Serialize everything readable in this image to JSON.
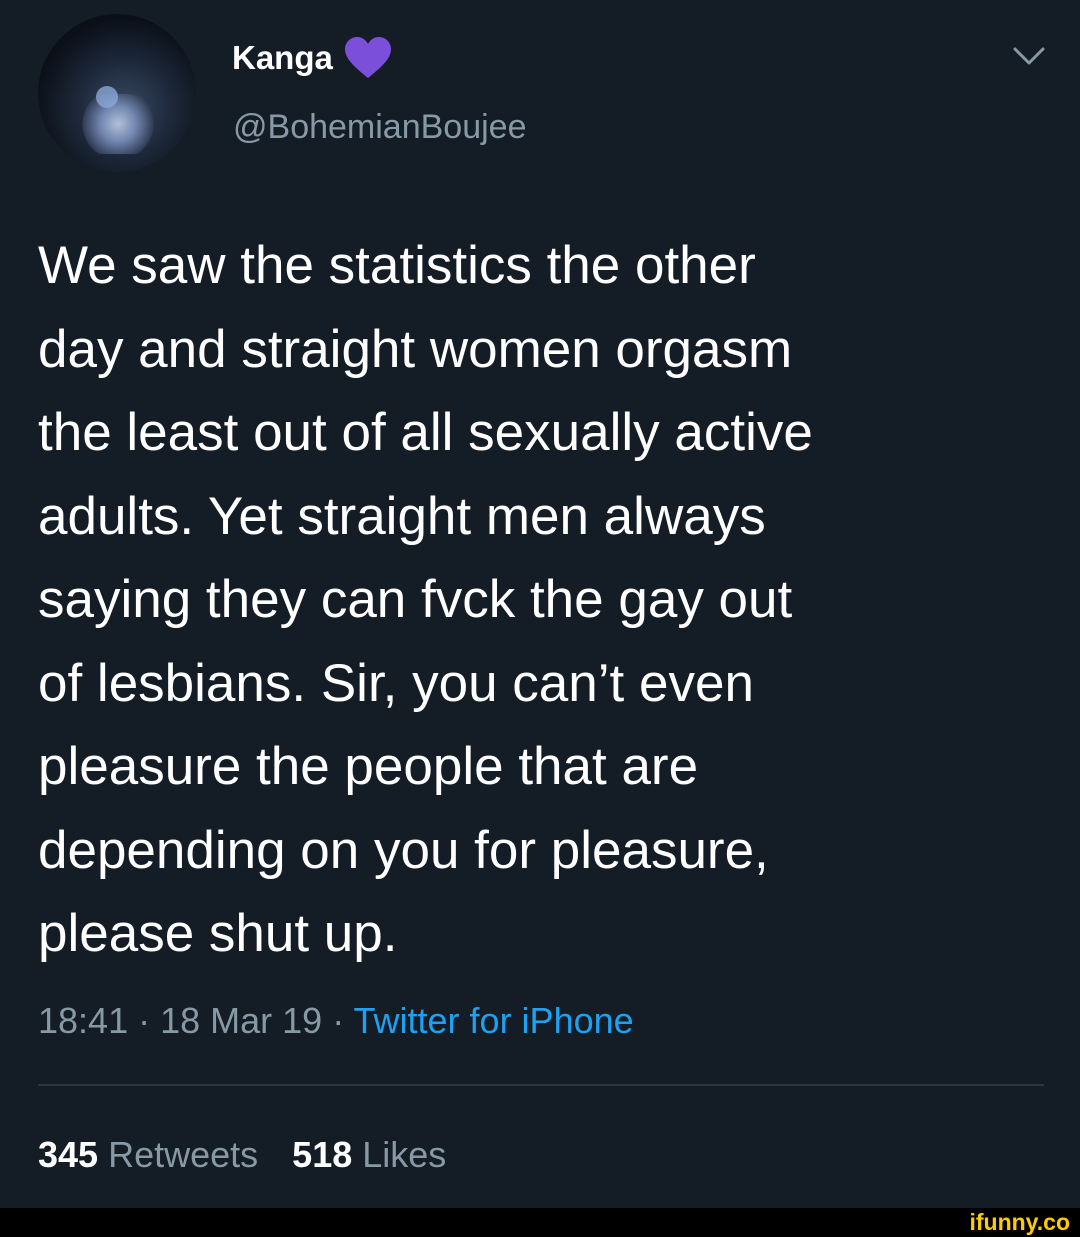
{
  "tweet": {
    "display_name": "Kanga",
    "handle": "@BohemianBoujee",
    "text": "We saw the statistics the other\nday and straight women orgasm\nthe least out of all sexually active\nadults. Yet straight men always\nsaying they can fvck the gay out\nof lesbians. Sir, you can’t even\npleasure the people that are\ndepending on you for pleasure,\nplease shut up.",
    "time": "18:41",
    "date": "18 Mar 19",
    "separator": " · ",
    "source": "Twitter for iPhone",
    "retweets_count": "345",
    "retweets_label": "Retweets",
    "likes_count": "518",
    "likes_label": "Likes"
  },
  "icons": {
    "heart": "purple-heart-icon",
    "menu": "chevron-down-icon"
  },
  "colors": {
    "background": "#141d26",
    "secondary_text": "#8899a6",
    "link": "#1da1f2",
    "heart": "#7b4fd9",
    "watermark": "#ffcc00"
  },
  "watermark": "ifunny.co"
}
